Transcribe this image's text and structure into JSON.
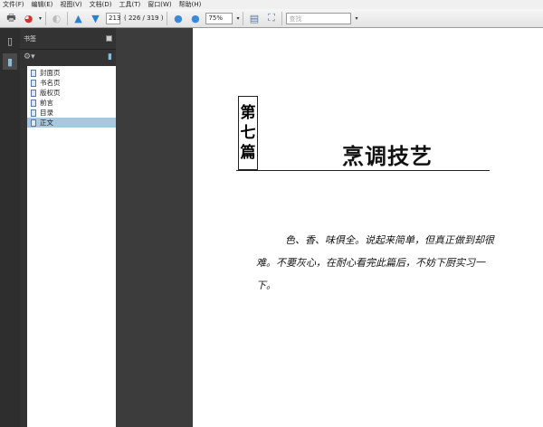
{
  "menu": [
    "文件(F)",
    "编辑(E)",
    "视图(V)",
    "文档(D)",
    "工具(T)",
    "窗口(W)",
    "帮助(H)"
  ],
  "toolbar": {
    "page_number": "213",
    "page_info": "( 226 / 319 )",
    "zoom": "75%",
    "search_placeholder": "查找"
  },
  "panel": {
    "title": "书签",
    "bookmarks": [
      {
        "label": "封面页",
        "selected": false
      },
      {
        "label": "书名页",
        "selected": false
      },
      {
        "label": "版权页",
        "selected": false
      },
      {
        "label": "前言",
        "selected": false
      },
      {
        "label": "目录",
        "selected": false
      },
      {
        "label": "正文",
        "selected": true
      }
    ]
  },
  "page": {
    "chapter": [
      "第",
      "七",
      "篇"
    ],
    "title": "烹调技艺",
    "body": "色、香、味俱全。说起来简单，但真正做到却很难。不要灰心，在耐心看完此篇后，不妨下厨实习一下。"
  }
}
